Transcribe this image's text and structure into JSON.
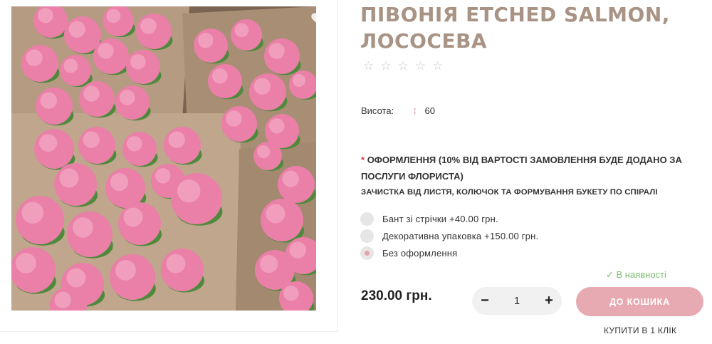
{
  "product": {
    "title": "ПІВОНІЯ ETCHED SALMON, ЛОСОСЕВА",
    "rating_stars": [
      "☆",
      "☆",
      "☆",
      "☆",
      "☆"
    ],
    "attributes": {
      "height_label": "Висота:",
      "height_icon": "↕",
      "height_value": "60"
    },
    "design": {
      "required_mark": "*",
      "heading": "ОФОРМЛЕННЯ (10% ВІД ВАРТОСТІ ЗАМОВЛЕННЯ БУДЕ ДОДАНО ЗА ПОСЛУГИ ФЛОРИСТА)",
      "subheading": "ЗАЧИСТКА ВІД ЛИСТЯ, КОЛЮЧОК ТА ФОРМУВАННЯ БУКЕТУ ПО СПІРАЛІ",
      "options": [
        {
          "label": "Бант зі стрічки +40.00 грн.",
          "selected": false
        },
        {
          "label": "Декоративна упаковка +150.00 грн.",
          "selected": false
        },
        {
          "label": "Без оформлення",
          "selected": true
        }
      ]
    },
    "stock": "✓ В наявності",
    "price": "230.00 грн.",
    "quantity": {
      "minus": "−",
      "value": "1",
      "plus": "+"
    },
    "add_to_cart": "ДО КОШИКА",
    "buy_one_click": "КУПИТИ В 1 КЛІК",
    "wishlist_icon": "heart-icon"
  },
  "colors": {
    "title": "#a89384",
    "accent_pink": "#e7a9b2",
    "in_stock": "#7cbf6e",
    "required": "#e23a3a"
  }
}
